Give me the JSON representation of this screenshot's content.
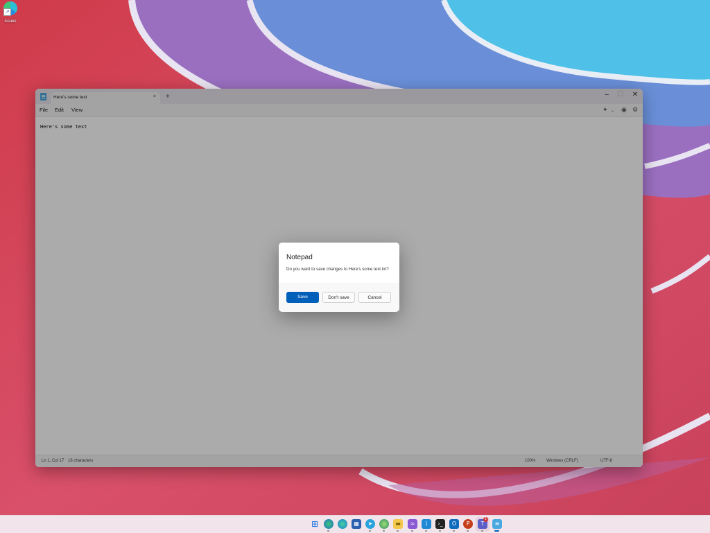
{
  "desktop": {
    "shortcut_label": "issues"
  },
  "window": {
    "tab_title": "Here's some text",
    "tab_close": "×",
    "new_tab": "+",
    "minimize": "–",
    "maximize": "☐",
    "close": "✕"
  },
  "menu": {
    "file": "File",
    "edit": "Edit",
    "view": "View"
  },
  "editor": {
    "content": "Here's some text"
  },
  "status": {
    "position": "Ln 1, Col 17",
    "characters": "16 characters",
    "zoom": "100%",
    "line_ending": "Windows (CRLF)",
    "encoding": "UTF-8"
  },
  "dialog": {
    "title": "Notepad",
    "message": "Do you want to save changes to Here's some text.txt?",
    "save": "Save",
    "dont_save": "Don't save",
    "cancel": "Cancel"
  },
  "taskbar": {
    "badge_count": "1",
    "icons": [
      "windows-start-icon",
      "edge-beta-icon",
      "edge-icon",
      "store-icon",
      "telegram-icon",
      "edge-dev-icon",
      "file-explorer-icon",
      "visual-studio-icon",
      "vscode-icon",
      "terminal-icon",
      "outlook-icon",
      "powerpoint-icon",
      "teams-icon",
      "notepad-icon"
    ]
  },
  "colors": {
    "accent": "#005fb8",
    "taskbar": "#f1e4ea"
  }
}
